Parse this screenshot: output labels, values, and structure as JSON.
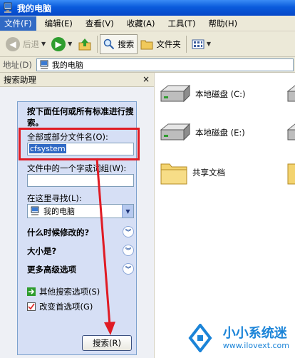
{
  "window": {
    "title": "我的电脑"
  },
  "menu": [
    {
      "label": "文件(F)",
      "active": true
    },
    {
      "label": "编辑(E)"
    },
    {
      "label": "查看(V)"
    },
    {
      "label": "收藏(A)"
    },
    {
      "label": "工具(T)"
    },
    {
      "label": "帮助(H)"
    }
  ],
  "toolbar": {
    "back_label": "后退",
    "search_label": "搜索",
    "folders_label": "文件夹"
  },
  "address": {
    "label": "地址(D)",
    "value": "我的电脑"
  },
  "search_pane": {
    "title": "搜索助理",
    "close": "×",
    "prompt": "按下面任何或所有标准进行搜索。",
    "filename_label": "全部或部分文件名(O):",
    "filename_value": "cfsystem",
    "content_label": "文件中的一个字或词组(W):",
    "content_value": "",
    "lookin_label": "在这里寻找(L):",
    "lookin_value": "我的电脑",
    "sections": [
      "什么时候修改的?",
      "大小是?",
      "更多高级选项"
    ],
    "links": [
      "其他搜索选项(S)",
      "改变首选项(G)"
    ],
    "search_button": "搜索(R)"
  },
  "files": [
    {
      "name": "本地磁盘 (C:)",
      "type": "drive"
    },
    {
      "name": "本地磁盘 (E:)",
      "type": "drive"
    },
    {
      "name": "共享文档",
      "type": "folder"
    }
  ],
  "watermark": {
    "text": "小小系统迷",
    "url": "www.ilovext.com"
  },
  "colors": {
    "highlight": "#e01b24",
    "selection": "#316ac5",
    "brand": "#1b84d8"
  }
}
